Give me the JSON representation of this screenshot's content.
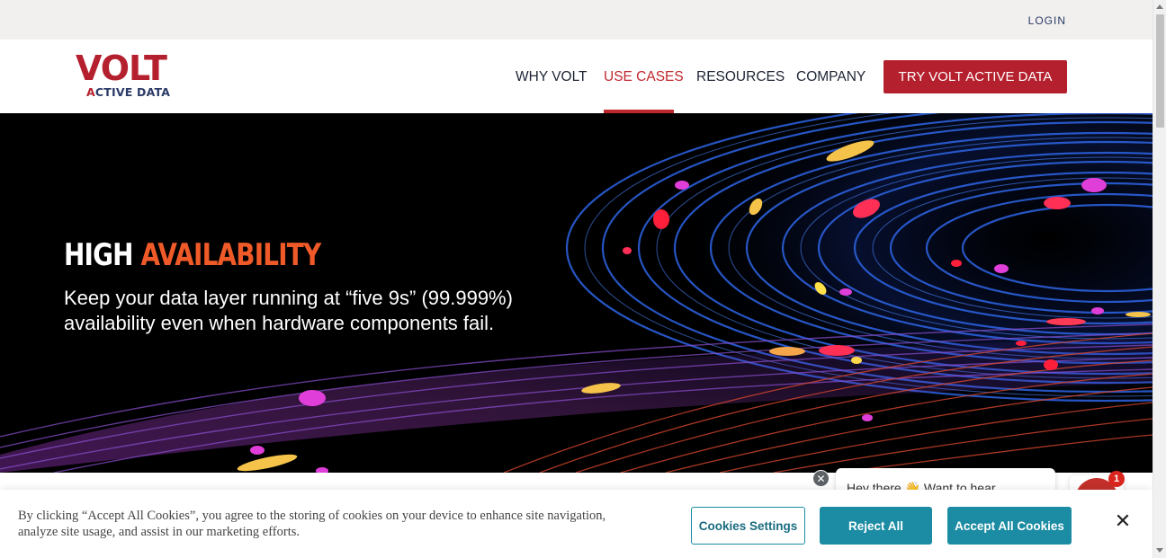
{
  "topbar": {
    "login_label": "LOGIN"
  },
  "logo": {
    "main": "VOLT",
    "sub_prefix": "",
    "sub_a": "A",
    "sub_rest": "CTIVE DATA"
  },
  "nav": {
    "items": [
      {
        "label": "WHY VOLT"
      },
      {
        "label": "USE CASES"
      },
      {
        "label": "RESOURCES"
      },
      {
        "label": "COMPANY"
      }
    ],
    "active_item": "USE CASES",
    "cta_label": "TRY VOLT ACTIVE DATA"
  },
  "hero": {
    "title_white": "HIGH ",
    "title_accent": "AVAILABILITY",
    "text": "Keep your data layer running at “five 9s” (99.999%) availability even when hardware components fail."
  },
  "chat": {
    "message": "Hey there 👋 Want to hear",
    "close_glyph": "✕",
    "badge_count": "1"
  },
  "cookie": {
    "text": "By clicking “Accept All Cookies”, you agree to the storing of cookies on your device to enhance site navigation, analyze site usage, and assist in our marketing efforts.",
    "settings_label": "Cookies Settings",
    "reject_label": "Reject All",
    "accept_label": "Accept All Cookies",
    "close_glyph": "✕"
  },
  "colors": {
    "brand_red": "#b5202e",
    "nav_active": "#c0272d",
    "hero_accent": "#f05a28",
    "cookie_teal": "#1b8ca3"
  },
  "icons": [
    "close-icon",
    "chat-icon",
    "scroll-up-icon",
    "scroll-down-icon"
  ]
}
